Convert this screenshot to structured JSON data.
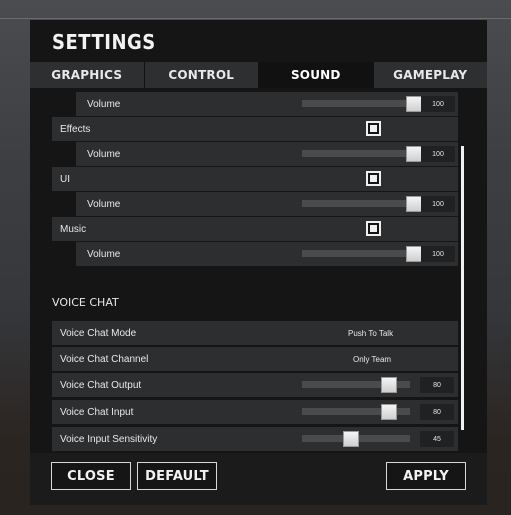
{
  "title": "SETTINGS",
  "tabs": [
    {
      "label": "GRAPHICS"
    },
    {
      "label": "CONTROL"
    },
    {
      "label": "SOUND"
    },
    {
      "label": "GAMEPLAY"
    }
  ],
  "sound": {
    "master_volume": {
      "label": "Volume",
      "value": "100"
    },
    "effects": {
      "label": "Effects",
      "checked": true,
      "volume_label": "Volume",
      "volume_value": "100"
    },
    "ui": {
      "label": "UI",
      "checked": true,
      "volume_label": "Volume",
      "volume_value": "100"
    },
    "music": {
      "label": "Music",
      "checked": true,
      "volume_label": "Volume",
      "volume_value": "100"
    }
  },
  "voice_chat": {
    "header": "VOICE CHAT",
    "mode": {
      "label": "Voice Chat Mode",
      "value": "Push To Talk"
    },
    "channel": {
      "label": "Voice Chat Channel",
      "value": "Only Team"
    },
    "output": {
      "label": "Voice Chat Output",
      "value": "80"
    },
    "input": {
      "label": "Voice Chat Input",
      "value": "80"
    },
    "sensitivity": {
      "label": "Voice Input Sensitivity",
      "value": "45"
    }
  },
  "footer": {
    "close_label": "CLOSE",
    "default_label": "DEFAULT",
    "apply_label": "APPLY"
  }
}
